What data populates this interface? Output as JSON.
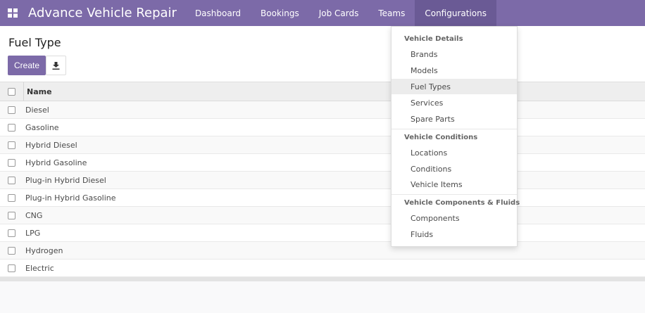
{
  "navbar": {
    "title": "Advance Vehicle Repair",
    "apps_icon": "grid-icon",
    "menu": [
      "Dashboard",
      "Bookings",
      "Job Cards",
      "Teams",
      "Configurations"
    ],
    "active_menu": "Configurations",
    "bg_color": "#7c6aa8"
  },
  "control": {
    "title": "Fuel Type",
    "create_label": "Create",
    "download_icon": "download-icon"
  },
  "table": {
    "column_header": "Name",
    "rows": [
      "Diesel",
      "Gasoline",
      "Hybrid Diesel",
      "Hybrid Gasoline",
      "Plug-in Hybrid Diesel",
      "Plug-in Hybrid Gasoline",
      "CNG",
      "LPG",
      "Hydrogen",
      "Electric"
    ]
  },
  "dropdown": {
    "sections": [
      {
        "header": "Vehicle Details",
        "items": [
          "Brands",
          "Models",
          "Fuel Types",
          "Services",
          "Spare Parts"
        ]
      },
      {
        "header": "Vehicle Conditions",
        "items": [
          "Locations",
          "Conditions",
          "Vehicle Items"
        ]
      },
      {
        "header": "Vehicle Components & Fluids",
        "items": [
          "Components",
          "Fluids"
        ]
      }
    ],
    "active_item": "Fuel Types"
  }
}
